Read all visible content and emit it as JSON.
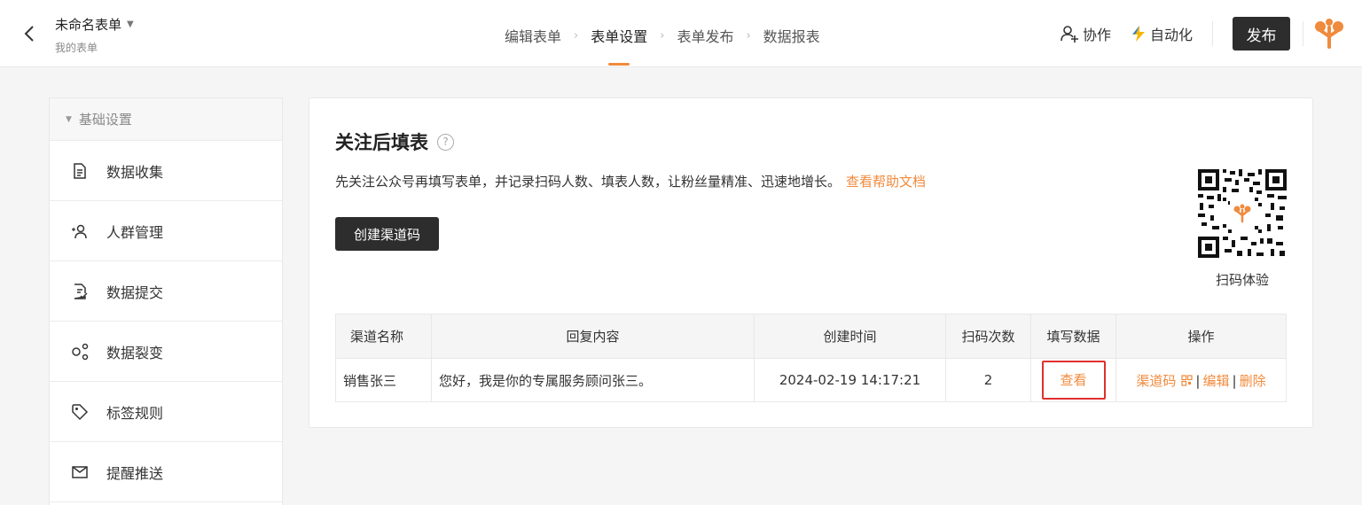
{
  "header": {
    "form_title": "未命名表单",
    "form_subtitle": "我的表单",
    "steps": [
      "编辑表单",
      "表单设置",
      "表单发布",
      "数据报表"
    ],
    "active_step": "表单设置",
    "collaborate_label": "协作",
    "automation_label": "自动化",
    "publish_label": "发布",
    "accent_color": "#f08a3c"
  },
  "sidebar": {
    "group_label": "基础设置",
    "items": [
      {
        "label": "数据收集",
        "icon": "document-icon"
      },
      {
        "label": "人群管理",
        "icon": "people-icon"
      },
      {
        "label": "数据提交",
        "icon": "submit-icon"
      },
      {
        "label": "数据裂变",
        "icon": "share-nodes-icon"
      },
      {
        "label": "标签规则",
        "icon": "tag-icon"
      },
      {
        "label": "提醒推送",
        "icon": "mail-icon"
      }
    ]
  },
  "main": {
    "title": "关注后填表",
    "description": "先关注公众号再填写表单，并记录扫码人数、填表人数，让粉丝量精准、迅速地增长。",
    "help_link": "查看帮助文档",
    "create_button": "创建渠道码",
    "qr_label": "扫码体验",
    "table": {
      "headers": [
        "渠道名称",
        "回复内容",
        "创建时间",
        "扫码次数",
        "填写数据",
        "操作"
      ],
      "rows": [
        {
          "channel": "销售张三",
          "reply": "您好，我是你的专属服务顾问张三。",
          "created": "2024-02-19 14:17:21",
          "scans": "2",
          "view": "查看",
          "op_code": "渠道码",
          "op_edit": "编辑",
          "op_delete": "删除",
          "op_separator": "|"
        }
      ]
    }
  }
}
